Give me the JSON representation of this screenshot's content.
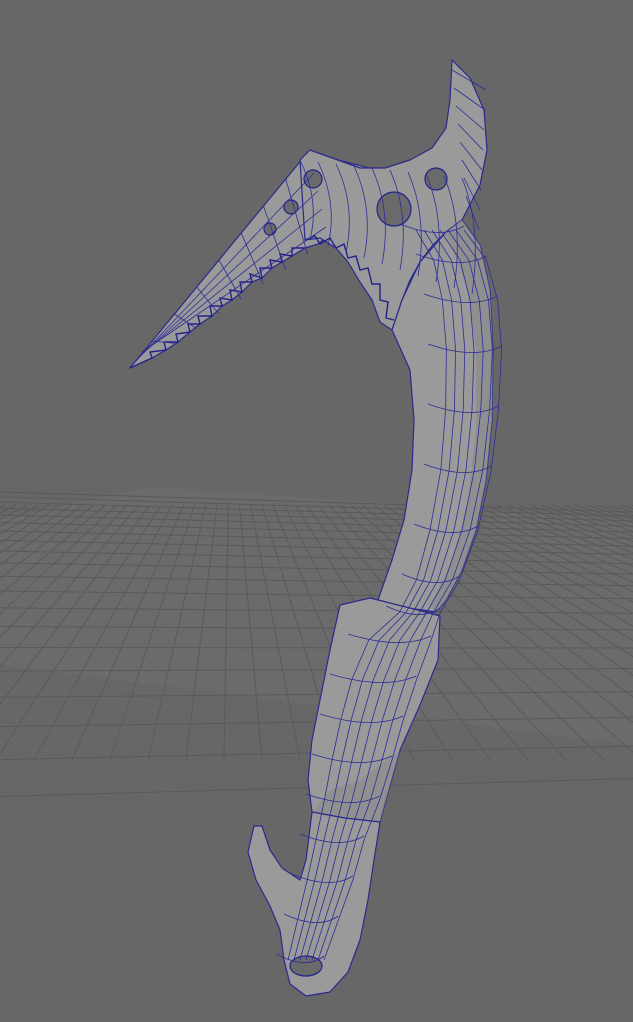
{
  "viewport": {
    "background_color": "#676767",
    "grid_color": "#5a5a5a",
    "wireframe_color": "#2d2d96",
    "surface_color": "#9a9a9a"
  },
  "scene": {
    "object": "ice-axe-mesh",
    "display_mode": "wireframe-on-shaded",
    "ground_grid": true
  }
}
